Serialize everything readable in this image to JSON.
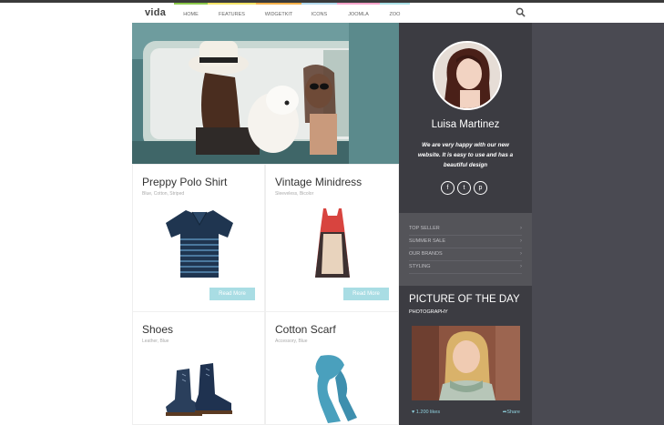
{
  "header": {
    "logo": "vida",
    "nav": [
      {
        "label": "HOME",
        "accent": "#8cc84b"
      },
      {
        "label": "FEATURES",
        "accent": "#f2e266"
      },
      {
        "label": "WIDGETKIT",
        "accent": "#f5b04a"
      },
      {
        "label": "ICONS",
        "accent": "#b2d8ec"
      },
      {
        "label": "JOOMLA",
        "accent": "#f7a3c9"
      },
      {
        "label": "ZOO",
        "accent": "#a9e0e6"
      }
    ],
    "search_icon": "search-icon"
  },
  "products": [
    {
      "title": "Preppy Polo Shirt",
      "tags": "Blue, Cotton, Striped",
      "button": "Read More",
      "image": "polo-shirt"
    },
    {
      "title": "Vintage Minidress",
      "tags": "Sleeveless, Bicolor",
      "button": "Read More",
      "image": "minidress"
    },
    {
      "title": "Shoes",
      "tags": "Leather, Blue",
      "button": "",
      "image": "boots"
    },
    {
      "title": "Cotton Scarf",
      "tags": "Accessory, Blue",
      "button": "",
      "image": "scarf"
    }
  ],
  "profile": {
    "name": "Luisa Martinez",
    "quote": "We are very happy with our new website. It is easy to use and has a beautiful design",
    "socials": [
      {
        "icon": "facebook-icon",
        "glyph": "f"
      },
      {
        "icon": "twitter-icon",
        "glyph": "t"
      },
      {
        "icon": "pinterest-icon",
        "glyph": "p"
      }
    ]
  },
  "menu": {
    "items": [
      "TOP SELLER",
      "SUMMER SALE",
      "OUR BRANDS",
      "STYLING"
    ]
  },
  "picture_of_day": {
    "title": "PICTURE OF THE DAY",
    "subtitle": "PHOTOGRAPHY",
    "likes": "1.200 likes",
    "share": "Share"
  },
  "colors": {
    "accent": "#a9dde4",
    "dark_panel": "#3c3c42",
    "menu_panel": "#545459",
    "side_dark": "#4a4a52"
  }
}
